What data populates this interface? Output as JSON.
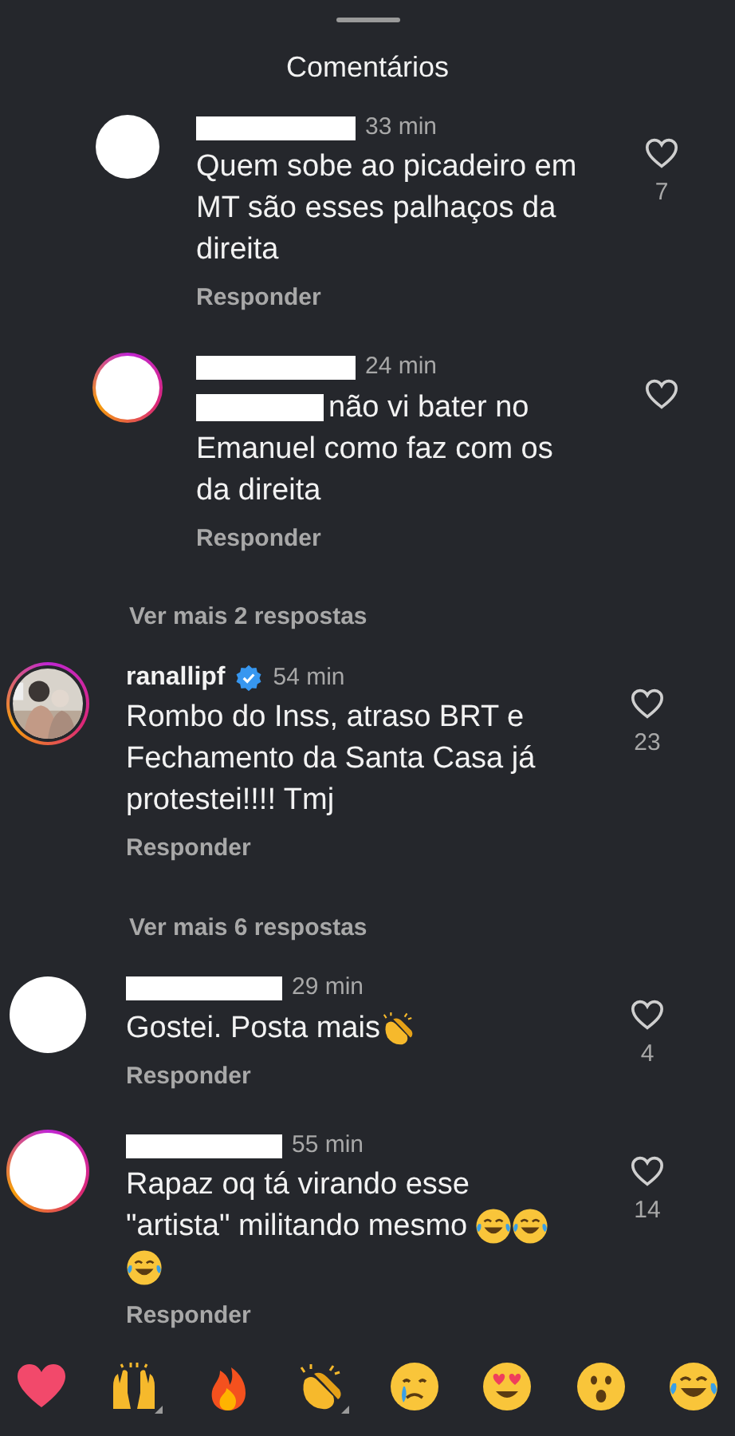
{
  "header": {
    "title": "Comentários"
  },
  "comments": [
    {
      "kind": "reply",
      "avatar": {
        "kind": "redacted"
      },
      "story_ring": false,
      "name_redacted": true,
      "verified": false,
      "time": "33 min",
      "mention_redacted": false,
      "text": "Quem sobe ao picadeiro em MT são esses palhaços da direita",
      "action": "Responder",
      "likes": "7"
    },
    {
      "kind": "reply",
      "avatar": {
        "kind": "redacted"
      },
      "story_ring": true,
      "name_redacted": true,
      "verified": false,
      "time": "24 min",
      "mention_redacted": true,
      "text": "não vi bater no Emanuel como faz com os da direita",
      "action": "Responder"
    },
    {
      "kind": "more_replies",
      "label": "Ver mais 2 respostas"
    },
    {
      "kind": "comment",
      "story_ring": true,
      "name_redacted": false,
      "username": "ranallipf",
      "verified": true,
      "time": "54 min",
      "mention_redacted": false,
      "text": "Rombo do Inss, atraso BRT e Fechamento da Santa Casa já protestei!!!! Tmj",
      "action": "Responder",
      "likes": "23"
    },
    {
      "kind": "more_replies",
      "label": "Ver mais 6 respostas"
    },
    {
      "kind": "comment",
      "avatar": {
        "kind": "redacted"
      },
      "story_ring": false,
      "name_redacted": true,
      "verified": false,
      "time": "29 min",
      "mention_redacted": false,
      "text": "Gostei. Posta mais",
      "emojis": [
        {
          "kind": "clap"
        }
      ],
      "action": "Responder",
      "likes": "4"
    },
    {
      "kind": "comment",
      "avatar": {
        "kind": "redacted"
      },
      "story_ring": true,
      "name_redacted": true,
      "verified": false,
      "time": "55 min",
      "mention_redacted": false,
      "text": "Rapaz oq tá virando esse \"artista\" militando mesmo",
      "emojis": [
        {
          "kind": "laugh"
        },
        {
          "kind": "laugh"
        },
        {
          "kind": "laugh"
        }
      ],
      "action": "Responder",
      "likes": "14"
    }
  ],
  "reactions": [
    {
      "kind": "heart",
      "variants": false
    },
    {
      "kind": "raised_hands",
      "variants": true
    },
    {
      "kind": "fire",
      "variants": false
    },
    {
      "kind": "clap",
      "variants": true
    },
    {
      "kind": "cry",
      "variants": false
    },
    {
      "kind": "heart_eyes",
      "variants": false
    },
    {
      "kind": "surprised",
      "variants": false
    },
    {
      "kind": "laugh",
      "variants": false
    }
  ]
}
